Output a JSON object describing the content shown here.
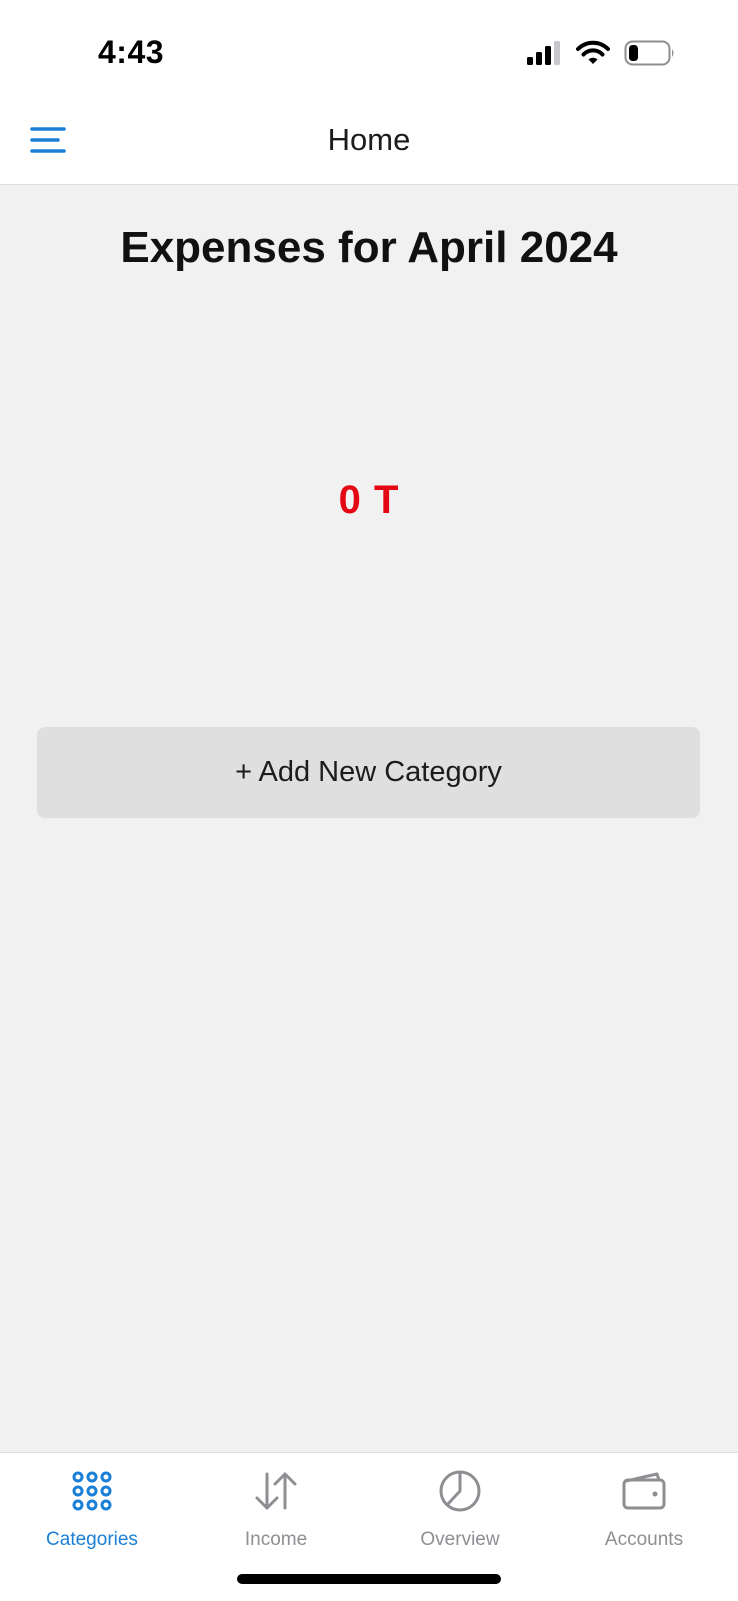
{
  "status_bar": {
    "time": "4:43",
    "icons": [
      "cellular-signal-icon",
      "wifi-icon",
      "battery-icon"
    ]
  },
  "header": {
    "title": "Home",
    "menu_icon": "hamburger-menu-icon"
  },
  "main": {
    "heading": "Expenses for April 2024",
    "total_amount": "0 T",
    "add_category_label": "+ Add New Category"
  },
  "tabs": [
    {
      "label": "Categories",
      "icon": "grid-dots-icon",
      "active": true
    },
    {
      "label": "Income",
      "icon": "up-down-arrows-icon",
      "active": false
    },
    {
      "label": "Overview",
      "icon": "pie-chart-icon",
      "active": false
    },
    {
      "label": "Accounts",
      "icon": "wallet-icon",
      "active": false
    }
  ],
  "colors": {
    "accent": "#1a7fd6",
    "inactive_tab": "#8e8e93",
    "amount": "#e30613",
    "background": "#f1f1f1",
    "button_bg": "#dfdfdf"
  }
}
